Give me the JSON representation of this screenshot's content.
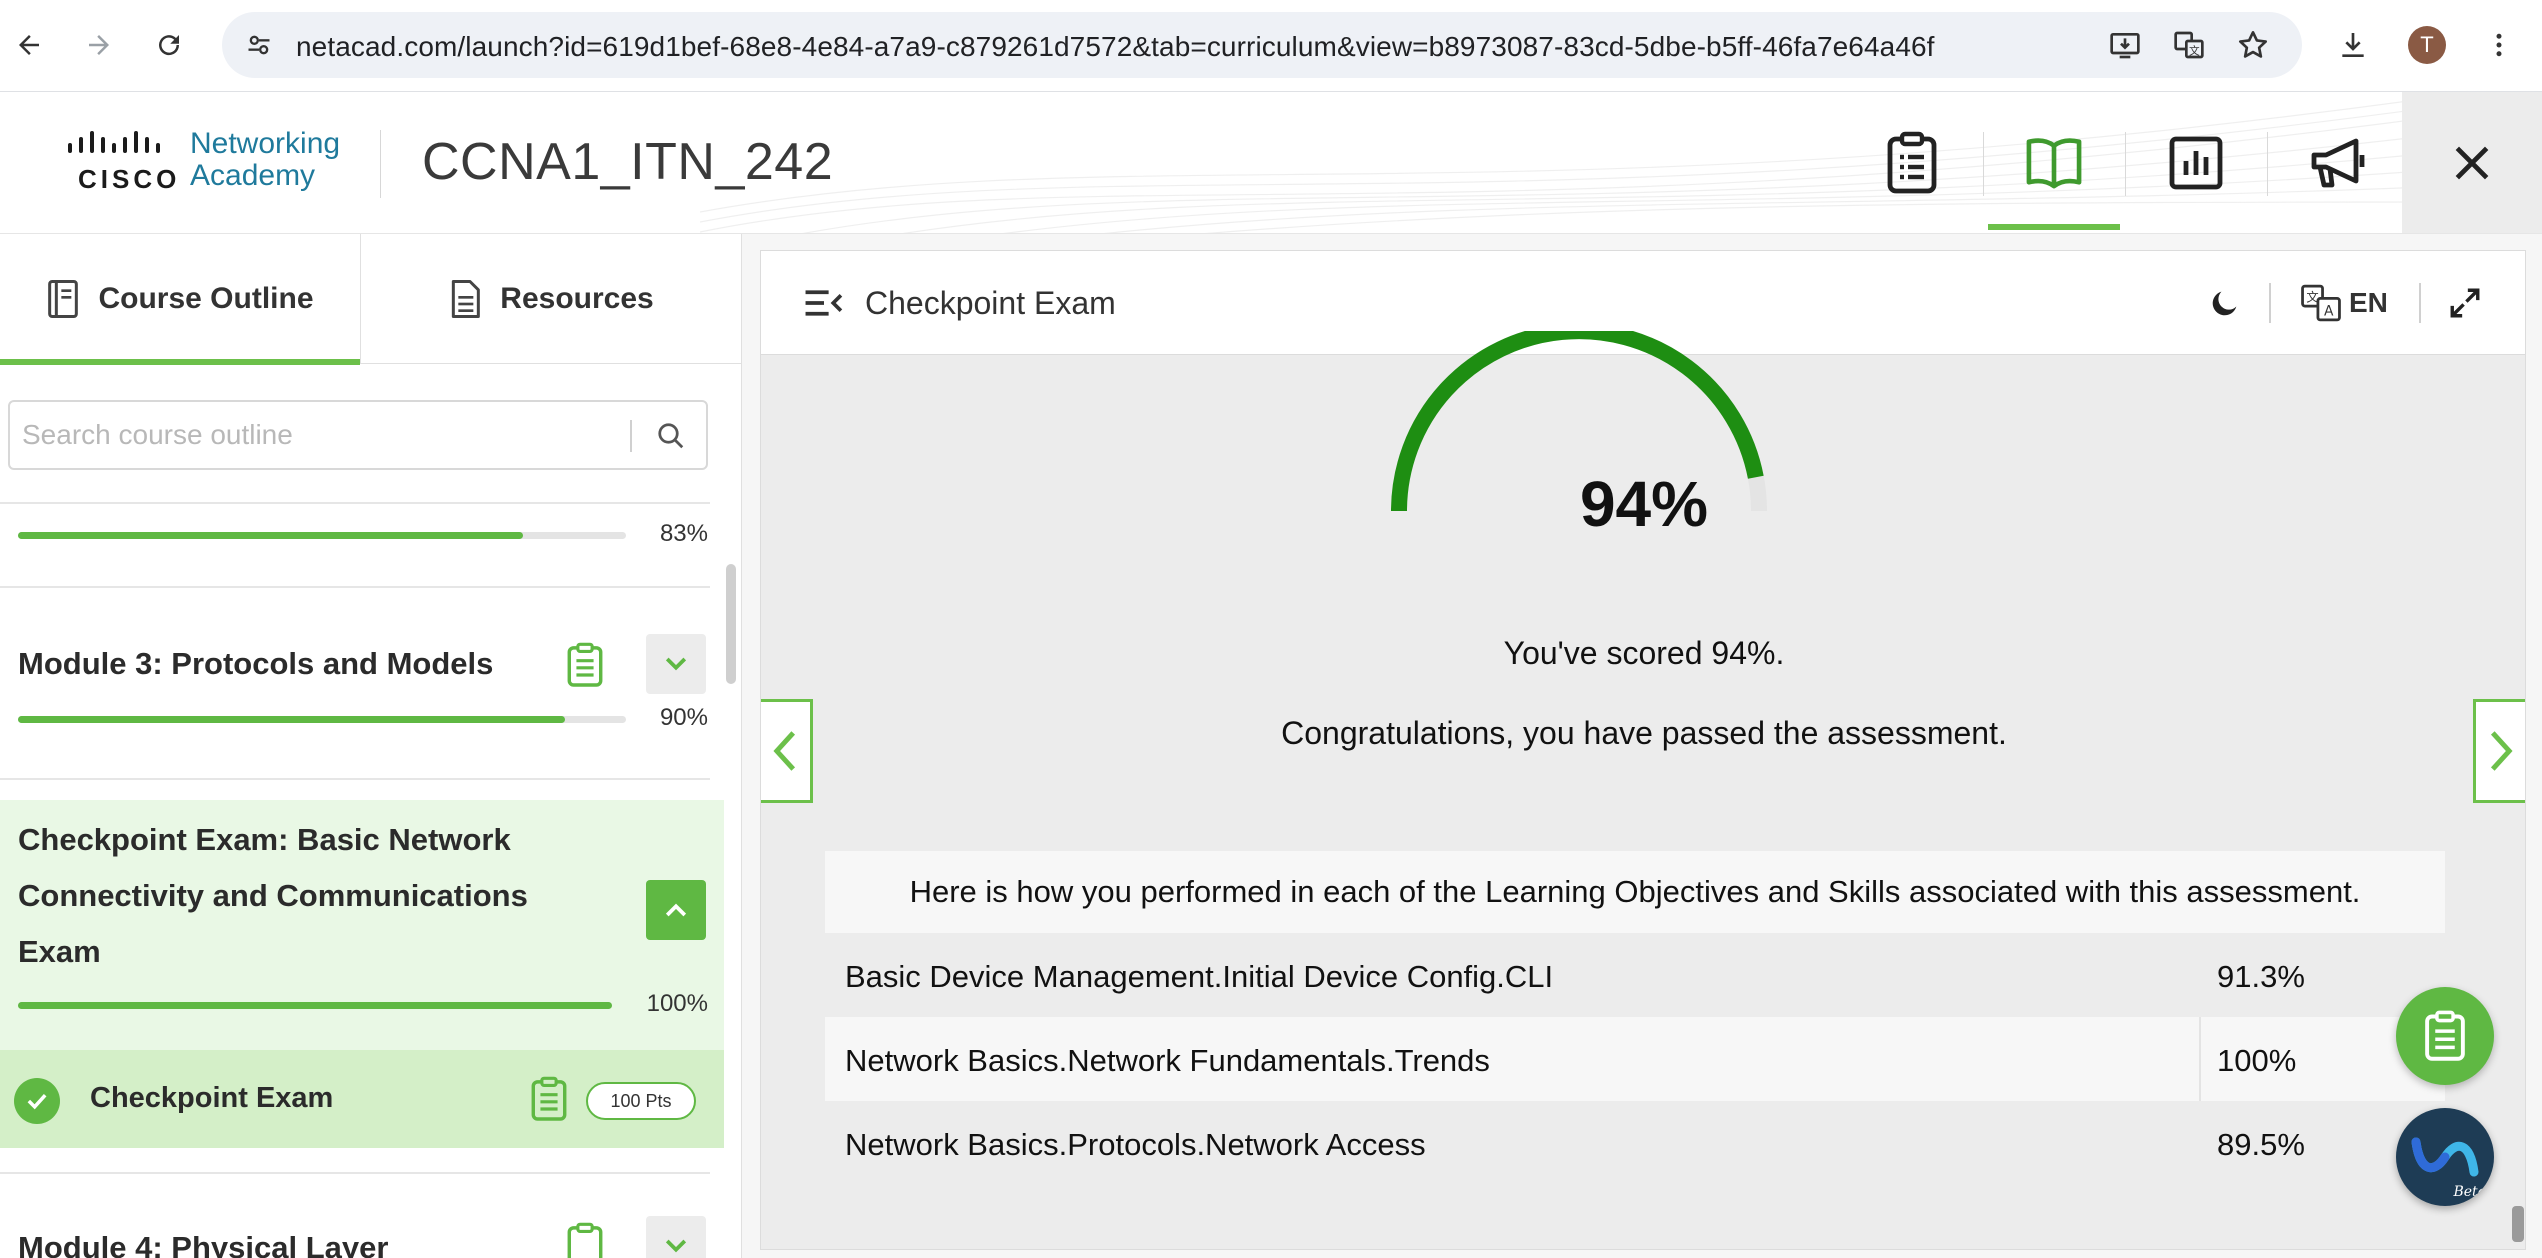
{
  "browser": {
    "url": "netacad.com/launch?id=619d1bef-68e8-4e84-a7a9-c879261d7572&tab=curriculum&view=b8973087-83cd-5dbe-b5ff-46fa7e64a46f",
    "profile_initial": "T",
    "icons": [
      "back-icon",
      "forward-icon",
      "reload-icon",
      "site-info-icon",
      "install-app-icon",
      "translate-icon",
      "bookmark-star-icon",
      "download-icon",
      "menu-dots-icon"
    ]
  },
  "header": {
    "logo_cisco": "CISCO",
    "logo_line1": "Networking",
    "logo_line2": "Academy",
    "course_title": "CCNA1_ITN_242",
    "active_icon": "book",
    "icons": [
      "clipboard-icon",
      "book-icon",
      "chart-icon",
      "megaphone-icon",
      "close-icon"
    ]
  },
  "sidebar": {
    "tabs": [
      {
        "label": "Course Outline",
        "active": true
      },
      {
        "label": "Resources",
        "active": false
      }
    ],
    "search_placeholder": "Search course outline",
    "top_progress": {
      "value": 0.83,
      "label": "83%"
    },
    "modules": [
      {
        "title": "Module 3: Protocols and Models",
        "progress": 0.9,
        "progress_label": "90%",
        "expanded": false
      },
      {
        "title": "Checkpoint Exam: Basic Network Connectivity and Communications Exam",
        "progress": 1.0,
        "progress_label": "100%",
        "expanded": true
      },
      {
        "title": "Module 4: Physical Layer",
        "expanded": false
      }
    ],
    "active_item": {
      "label": "Checkpoint Exam",
      "points": "100 Pts",
      "completed": true
    }
  },
  "panel": {
    "title": "Checkpoint Exam",
    "language": "EN",
    "score": {
      "value": 0.94,
      "label": "94%"
    },
    "scored_text": "You've scored 94%.",
    "congrats_text": "Congratulations, you have passed the assessment.",
    "objectives_heading": "Here is how you performed in each of the Learning Objectives and Skills associated with this assessment.",
    "objectives": [
      {
        "name": "Basic Device Management.Initial Device Config.CLI",
        "score": "91.3%"
      },
      {
        "name": "Network Basics.Network Fundamentals.Trends",
        "score": "100%"
      },
      {
        "name": "Network Basics.Protocols.Network Access",
        "score": "89.5%"
      }
    ]
  },
  "colors": {
    "accent_green": "#5fb843",
    "gauge_green": "#1e8e12",
    "highlight_bg": "#e9f8e5",
    "active_item_bg": "#d4efc8"
  }
}
